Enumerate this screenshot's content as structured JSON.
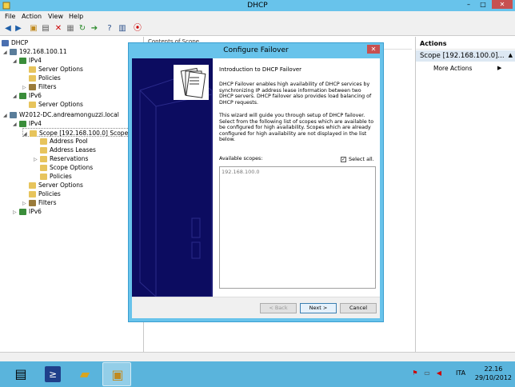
{
  "window": {
    "title": "DHCP",
    "minimize": "–",
    "maximize": "□",
    "close": "✕"
  },
  "menu": [
    "File",
    "Action",
    "View",
    "Help"
  ],
  "toolbar_icons": [
    "back-icon",
    "forward-icon",
    "up-icon",
    "properties-icon",
    "delete-icon",
    "export-icon",
    "refresh-icon",
    "help-icon",
    "console-icon",
    "stop-icon"
  ],
  "tree": {
    "root": "DHCP",
    "server1": "192.168.100.11",
    "ipv4_1": "IPv4",
    "server_options_1": "Server Options",
    "policies_1": "Policies",
    "filters_1": "Filters",
    "ipv6_1": "IPv6",
    "server_options_1b": "Server Options",
    "server2": "W2012-DC.andreamonguzzi.local",
    "ipv4_2": "IPv4",
    "scope": "Scope [192.168.100.0] Scope 1",
    "address_pool": "Address Pool",
    "address_leases": "Address Leases",
    "reservations": "Reservations",
    "scope_options": "Scope Options",
    "scope_policies": "Policies",
    "server_options_2": "Server Options",
    "policies_2": "Policies",
    "filters_2": "Filters",
    "ipv6_2": "IPv6"
  },
  "center": {
    "header": "Contents of Scope"
  },
  "actions": {
    "header": "Actions",
    "scope": "Scope [192.168.100.0]...",
    "more": "More Actions"
  },
  "dialog": {
    "title": "Configure Failover",
    "close": "✕",
    "intro_title": "Introduction to DHCP Failover",
    "para1": "DHCP Failover enables high availability of DHCP services by synchronizing IP address lease information between two DHCP servers. DHCP failover also provides load balancing of DHCP requests.",
    "para2": "This wizard will guide you through setup of DHCP failover. Select from the following list of scopes which are available to be configured for high availability. Scopes which are already configured for high availability are not displayed in the list below.",
    "available_label": "Available scopes:",
    "select_all": "Select all.",
    "scopes": [
      "192.168.100.0"
    ],
    "back": "< Back",
    "next": "Next >",
    "cancel": "Cancel"
  },
  "taskbar": {
    "lang": "ITA",
    "time": "22.16",
    "date": "29/10/2012"
  }
}
